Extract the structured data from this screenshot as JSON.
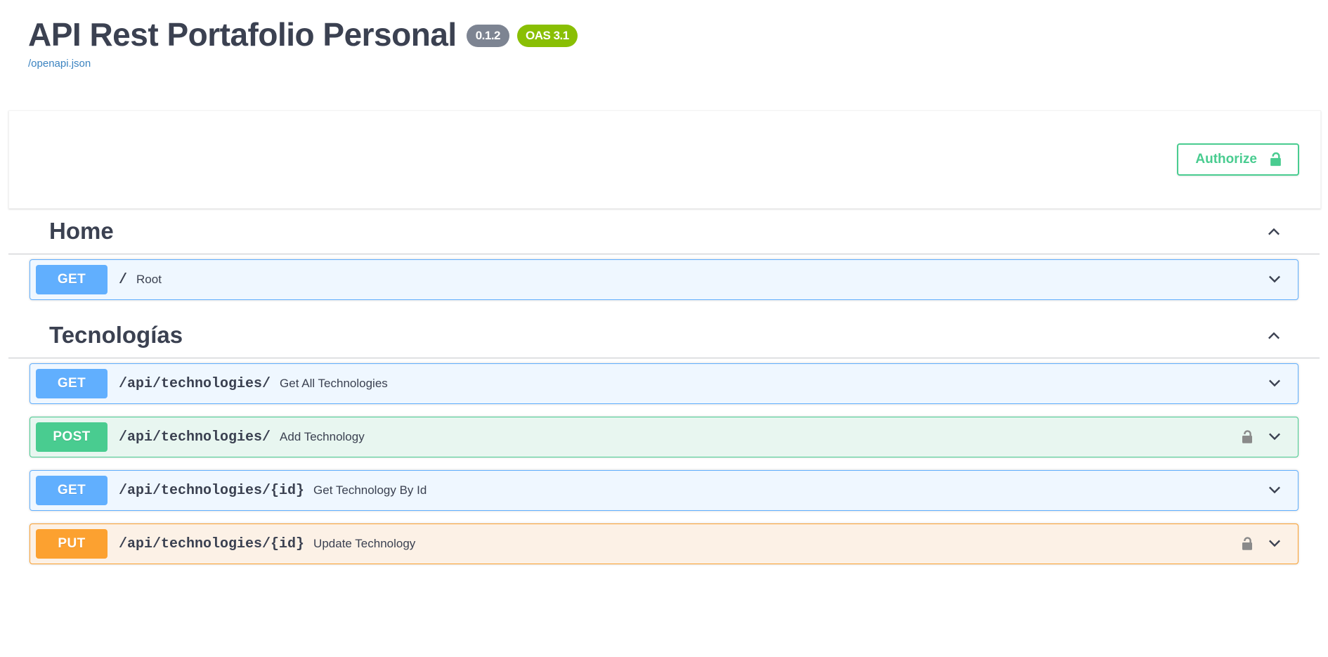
{
  "info": {
    "title": "API Rest Portafolio Personal",
    "version_badge": "0.1.2",
    "oas_badge": "OAS 3.1",
    "spec_url": "/openapi.json"
  },
  "scheme": {
    "authorize_label": "Authorize",
    "authorize_icon": "unlock-icon"
  },
  "colors": {
    "get": "#61affe",
    "post": "#49cc90",
    "put": "#fca130",
    "version_badge": "#7d8492",
    "oas_badge": "#89bf04",
    "link": "#3b83c0",
    "text": "#3b4151"
  },
  "sections": [
    {
      "tag": "Home",
      "toggle_icon": "chevron-up-icon",
      "operations": [
        {
          "method": "GET",
          "path": "/",
          "summary": "Root",
          "locked": false,
          "arrow_icon": "chevron-down-icon"
        }
      ]
    },
    {
      "tag": "Tecnologías",
      "toggle_icon": "chevron-up-icon",
      "operations": [
        {
          "method": "GET",
          "path": "/api/technologies/",
          "summary": "Get All Technologies",
          "locked": false,
          "arrow_icon": "chevron-down-icon"
        },
        {
          "method": "POST",
          "path": "/api/technologies/",
          "summary": "Add Technology",
          "locked": true,
          "lock_icon": "unlock-icon",
          "arrow_icon": "chevron-down-icon"
        },
        {
          "method": "GET",
          "path": "/api/technologies/{id}",
          "summary": "Get Technology By Id",
          "locked": false,
          "arrow_icon": "chevron-down-icon"
        },
        {
          "method": "PUT",
          "path": "/api/technologies/{id}",
          "summary": "Update Technology",
          "locked": true,
          "lock_icon": "unlock-icon",
          "arrow_icon": "chevron-down-icon"
        }
      ]
    }
  ]
}
